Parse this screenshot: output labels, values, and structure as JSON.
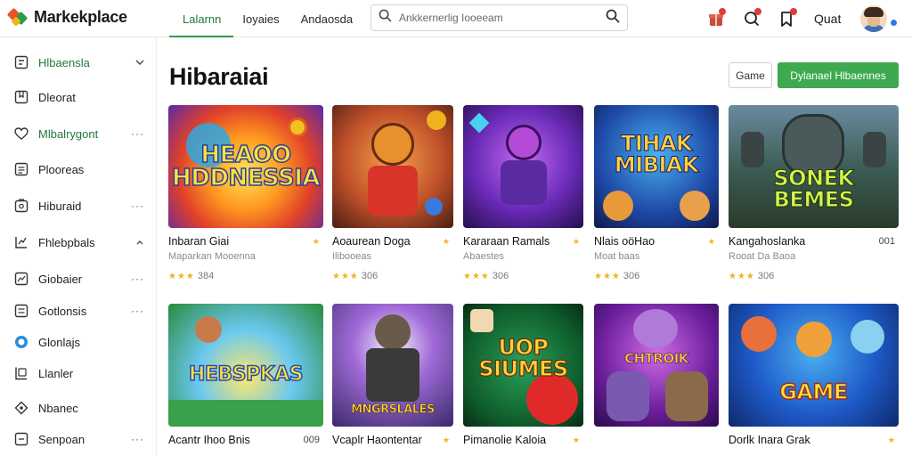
{
  "header": {
    "logo_text": "Markekplace",
    "tabs": [
      {
        "label": "Lalarnn",
        "active": true
      },
      {
        "label": "Ioyaies",
        "active": false
      },
      {
        "label": "Andaosda",
        "active": false
      }
    ],
    "search_placeholder": "Ankkernerlig Iooeeam",
    "quest_label": "Quat",
    "notification_color": "#e23b3b"
  },
  "sidebar": {
    "items": [
      {
        "label": "Hlbaensla",
        "icon": "storefront-icon",
        "right": "chevron",
        "active": true
      },
      {
        "label": "Dleorat",
        "icon": "bookmark-icon",
        "right": "",
        "active": false
      },
      {
        "label": "Mlbalrygont",
        "icon": "heart-icon",
        "right": "dots",
        "active": true
      },
      {
        "label": "Plooreas",
        "icon": "grid-icon",
        "right": "",
        "active": false
      },
      {
        "label": "Hiburaid",
        "icon": "image-icon",
        "right": "dots",
        "active": false
      },
      {
        "label": "Fhlebpbals",
        "icon": "chart-icon",
        "right": "caret",
        "active": false
      },
      {
        "label": "Giobaier",
        "icon": "trend-icon",
        "right": "dots",
        "active": false
      },
      {
        "label": "Gotlonsis",
        "icon": "list-icon",
        "right": "dots",
        "active": false
      },
      {
        "label": "Glonlajs",
        "icon": "circle-icon",
        "right": "",
        "active": false
      },
      {
        "label": "Llanler",
        "icon": "tag-icon",
        "right": "",
        "active": false
      },
      {
        "label": "Nbanec",
        "icon": "pin-icon",
        "right": "",
        "active": false
      },
      {
        "label": "Senpoan",
        "icon": "card-icon",
        "right": "dots",
        "active": false
      }
    ]
  },
  "main": {
    "title": "Hibaraiai",
    "game_button": "Game",
    "action_button": "Dylanael Hlbaennes",
    "accent_color": "#3daa4f",
    "row1": [
      {
        "art": "HEAOO\nHDDNESSIA",
        "title": "Inbaran Giai",
        "sub": "Maparkan Mooenna",
        "rating": "384",
        "stars": "★★★",
        "badge": "★"
      },
      {
        "art": "",
        "title": "Aoaurean Doga",
        "sub": "Ilibooeas",
        "rating": "306",
        "stars": "★★★",
        "badge": "★"
      },
      {
        "art": "",
        "title": "Kararaan Ramals",
        "sub": "Abaestes",
        "rating": "306",
        "stars": "★★★",
        "badge": "★"
      },
      {
        "art": "TIHAK\nMIBIAK",
        "title": "Nlais oöHao",
        "sub": "Moat baas",
        "rating": "306",
        "stars": "★★★",
        "badge": "★"
      },
      {
        "art": "SONEK\nBEMES",
        "title": "Kangahoslanka",
        "sub": "Rooat Da Baoa",
        "rating": "306",
        "stars": "★★★",
        "badge": "001"
      }
    ],
    "row2": [
      {
        "art": "HEBSPKAS",
        "title": "Acantr Ihoo Bnis",
        "badge": "009"
      },
      {
        "art": "MNGRSLALES",
        "title": "Vcaplr Haontentar",
        "badge": "★"
      },
      {
        "art": "UOP\nSIUMES",
        "title": "Pimanolie Kaloia",
        "badge": "★"
      },
      {
        "art": "CHTROIK",
        "title": "",
        "badge": ""
      },
      {
        "art": "GAME",
        "title": "Dorlk Inara Grak",
        "badge": "★"
      }
    ]
  }
}
